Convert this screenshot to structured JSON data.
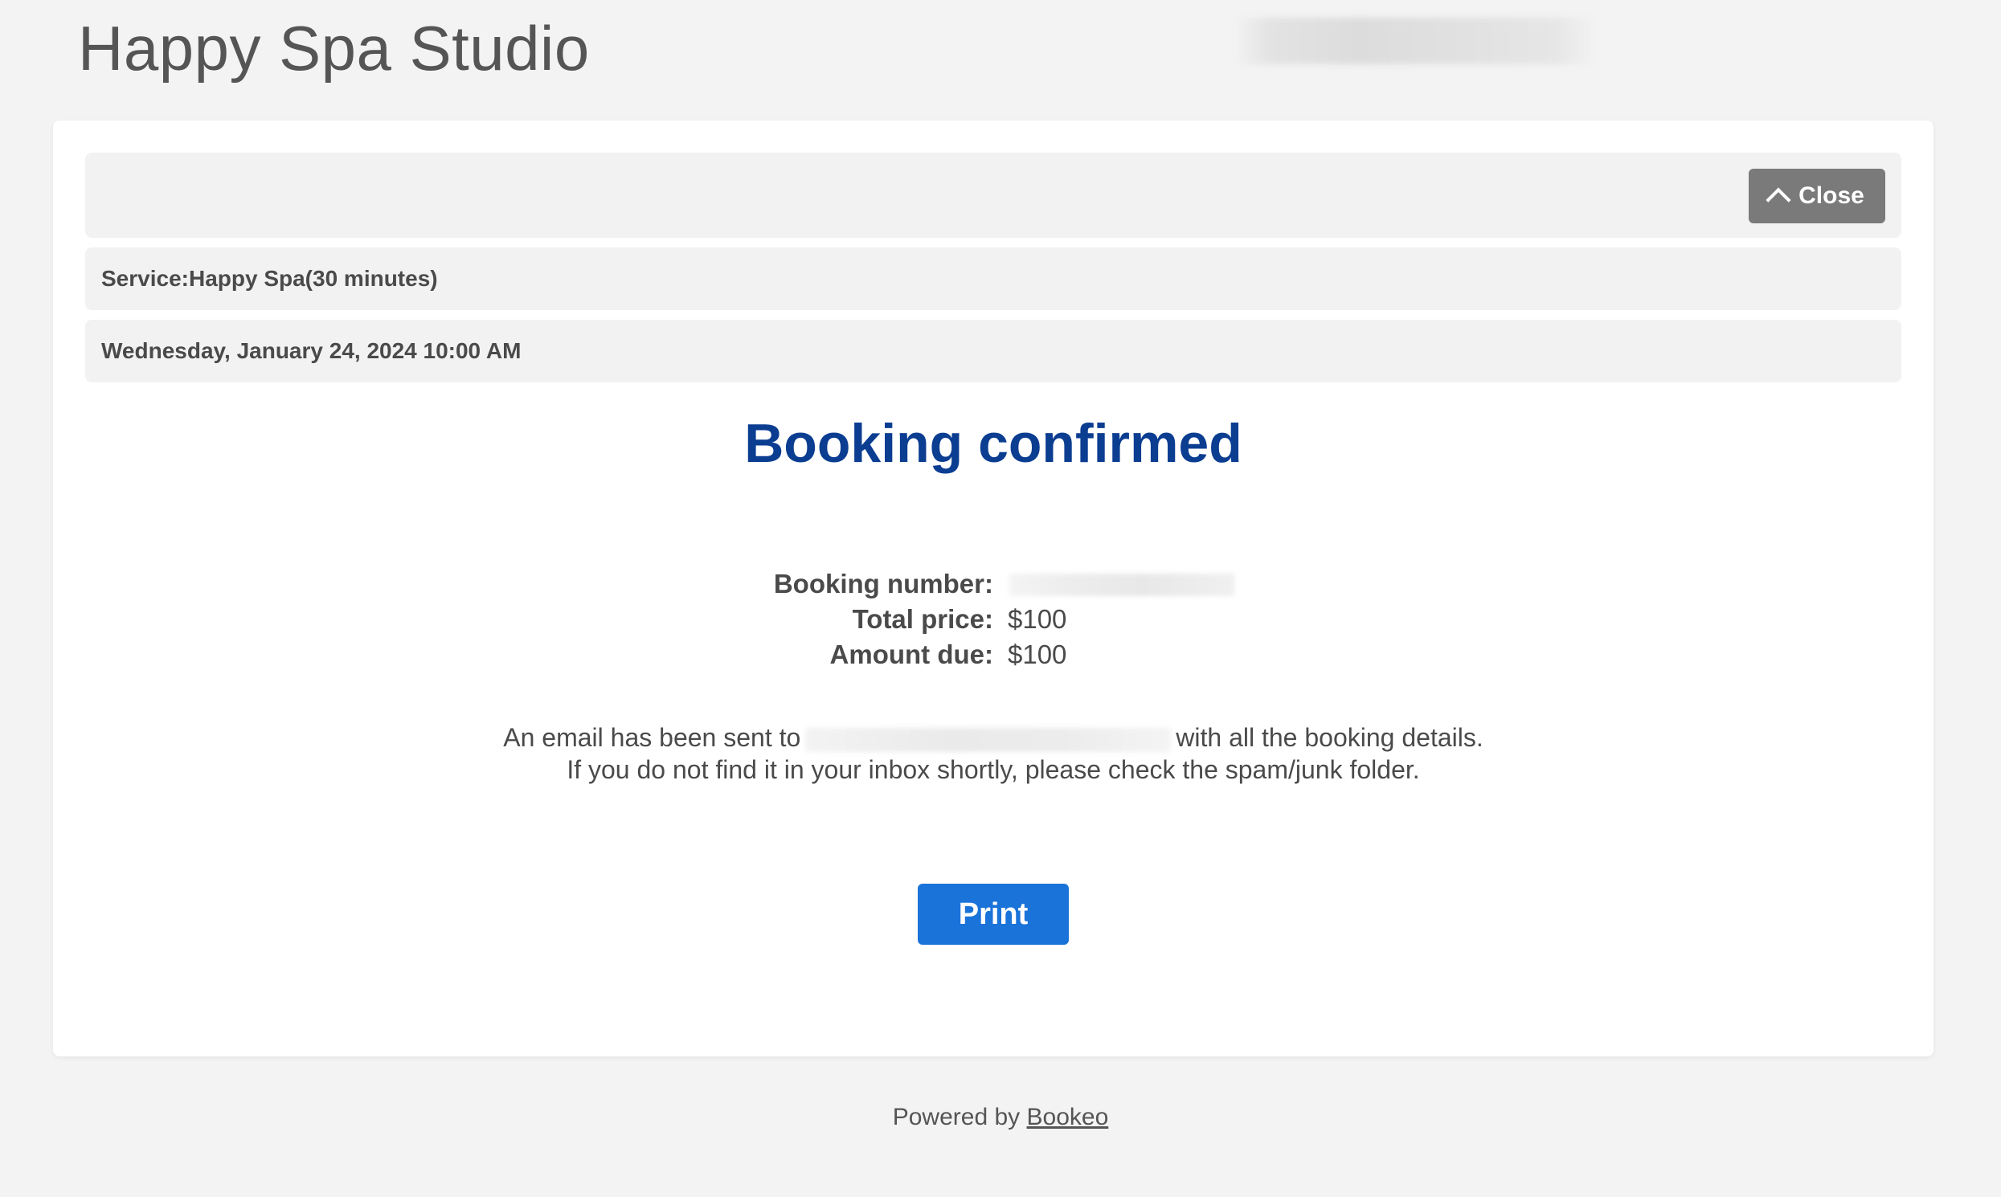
{
  "header": {
    "site_title": "Happy Spa Studio"
  },
  "booking_bar": {
    "close_label": "Close",
    "service_label": "Service:",
    "service_name": "Happy Spa",
    "service_duration": "(30 minutes)",
    "datetime": "Wednesday, January 24, 2024 10:00 AM"
  },
  "confirmation": {
    "title": "Booking confirmed",
    "booking_number_label": "Booking number:",
    "total_price_label": "Total price:",
    "total_price_value": "$100",
    "amount_due_label": "Amount due:",
    "amount_due_value": "$100",
    "email_prefix": "An email has been sent to",
    "email_suffix": "with all the booking details.",
    "email_note": "If you do not find it in your inbox shortly, please check the spam/junk folder.",
    "print_label": "Print"
  },
  "footer": {
    "powered_by": "Powered by",
    "brand_link": "Bookeo"
  },
  "colors": {
    "title_blue": "#0b3d91",
    "print_button": "#1a73d9",
    "close_button": "#7a7a7a",
    "page_background": "#f3f3f3"
  },
  "icons": {
    "close": "chevron-up-icon"
  }
}
